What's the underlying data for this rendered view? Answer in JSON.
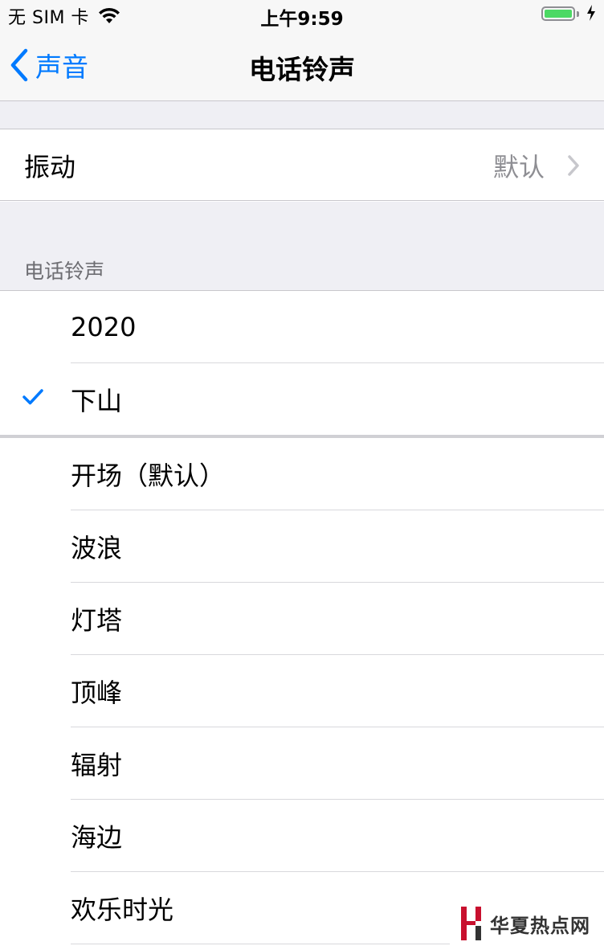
{
  "status_bar": {
    "carrier": "无 SIM 卡",
    "time": "上午9:59",
    "battery_level": 1.0,
    "icons": [
      "wifi-icon",
      "battery-icon",
      "charging-bolt-icon"
    ]
  },
  "nav": {
    "back_label": "声音",
    "title": "电话铃声"
  },
  "vibration": {
    "label": "振动",
    "value": "默认"
  },
  "ringtones": {
    "section_header": "电话铃声",
    "custom": [
      {
        "label": "2020",
        "selected": false
      },
      {
        "label": "下山",
        "selected": true
      }
    ],
    "builtin": [
      {
        "label": "开场（默认）"
      },
      {
        "label": "波浪"
      },
      {
        "label": "灯塔"
      },
      {
        "label": "顶峰"
      },
      {
        "label": "辐射"
      },
      {
        "label": "海边"
      },
      {
        "label": "欢乐时光"
      }
    ]
  },
  "watermark": {
    "text": "华夏热点网"
  },
  "colors": {
    "accent": "#007aff",
    "background": "#efeff4",
    "battery": "#4cd964",
    "watermark": "#c8102e"
  }
}
